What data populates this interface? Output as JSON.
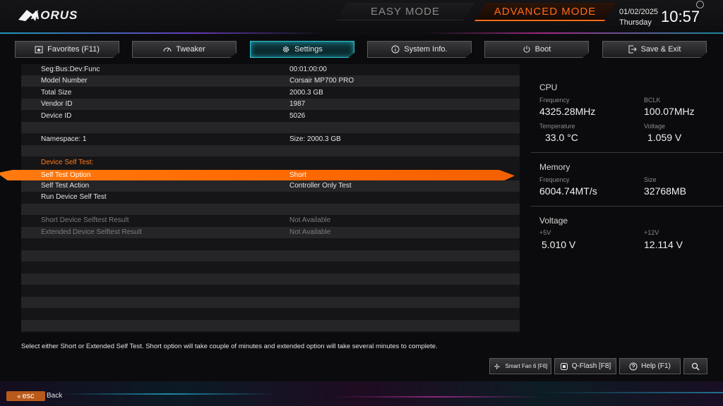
{
  "header": {
    "logo": "AORUS",
    "easy_mode": "EASY MODE",
    "advanced_mode": "ADVANCED MODE",
    "date": "01/02/2025",
    "day": "Thursday",
    "time": "10:57"
  },
  "tabs": [
    {
      "label": "Favorites (F11)",
      "icon": "favorites-icon"
    },
    {
      "label": "Tweaker",
      "icon": "speedometer-icon"
    },
    {
      "label": "Settings",
      "icon": "gear-icon",
      "active": true
    },
    {
      "label": "System Info.",
      "icon": "info-icon"
    },
    {
      "label": "Boot",
      "icon": "power-icon"
    },
    {
      "label": "Save & Exit",
      "icon": "exit-icon"
    }
  ],
  "settings": {
    "rows": [
      {
        "label": "Seg:Bus:Dev:Func",
        "value": "00:01:00:00"
      },
      {
        "label": "Model Number",
        "value": "Corsair MP700 PRO"
      },
      {
        "label": "Total Size",
        "value": "2000.3 GB"
      },
      {
        "label": "Vendor ID",
        "value": "1987"
      },
      {
        "label": "Device ID",
        "value": "5026"
      },
      {
        "label": "",
        "value": ""
      },
      {
        "label": "Namespace: 1",
        "value": "Size: 2000.3 GB"
      },
      {
        "label": "",
        "value": ""
      },
      {
        "label": "Device Self Test:",
        "value": ""
      },
      {
        "label": "Self Test Option",
        "value": "Short"
      },
      {
        "label": "Self Test Action",
        "value": "Controller Only Test"
      },
      {
        "label": "Run Device Self Test",
        "value": ""
      },
      {
        "label": "",
        "value": ""
      },
      {
        "label": "Short Device Selftest Result",
        "value": "Not Available"
      },
      {
        "label": "Extended Device Selftest Result",
        "value": "Not Available"
      }
    ]
  },
  "hw": {
    "cpu": {
      "title": "CPU",
      "frequency_label": "Frequency",
      "frequency": "4325.28MHz",
      "bclk_label": "BCLK",
      "bclk": "100.07MHz",
      "temperature_label": "Temperature",
      "temperature": "33.0 °C",
      "voltage_label": "Voltage",
      "voltage": "1.059 V"
    },
    "memory": {
      "title": "Memory",
      "frequency_label": "Frequency",
      "frequency": "6004.74MT/s",
      "size_label": "Size",
      "size": "32768MB"
    },
    "voltage": {
      "title": "Voltage",
      "v5_label": "+5V",
      "v5": "5.010 V",
      "v12_label": "+12V",
      "v12": "12.114 V"
    }
  },
  "footer": {
    "description": "Select either Short or Extended Self Test. Short option will take couple of minutes and extended option will take several minutes to complete.",
    "smart_fan": "Smart Fan 6 [F6]",
    "qflash": "Q-Flash [F8]",
    "help": "Help (F1)",
    "esc": "esc",
    "back": "Back"
  },
  "colors": {
    "accent": "#ff6a1a",
    "selected_row": "#ff7a10",
    "active_tab_border": "#29c6d6"
  }
}
